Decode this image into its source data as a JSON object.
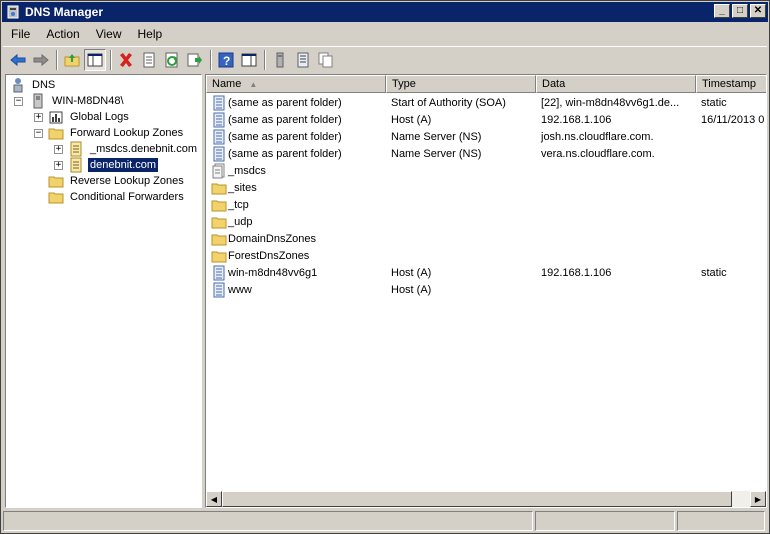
{
  "window": {
    "title": "DNS Manager",
    "controls": [
      "_",
      "□",
      "✕"
    ]
  },
  "menu": [
    "File",
    "Action",
    "View",
    "Help"
  ],
  "tree": {
    "root": "DNS",
    "server": "WIN-M8DN48\\",
    "global_logs": "Global Logs",
    "forward_zones": "Forward Lookup Zones",
    "msdcs_zone": "_msdcs.denebnit.com",
    "selected_zone": "denebnit.com",
    "reverse_zones": "Reverse Lookup Zones",
    "conditional_forwarders": "Conditional Forwarders"
  },
  "columns": {
    "name": "Name",
    "type": "Type",
    "data": "Data",
    "timestamp": "Timestamp"
  },
  "records": [
    {
      "icon": "record-icon",
      "name": "(same as parent folder)",
      "type": "Start of Authority (SOA)",
      "data": "[22], win-m8dn48vv6g1.de...",
      "timestamp": "static"
    },
    {
      "icon": "record-icon",
      "name": "(same as parent folder)",
      "type": "Host (A)",
      "data": "192.168.1.106",
      "timestamp": "16/11/2013 0"
    },
    {
      "icon": "record-icon",
      "name": "(same as parent folder)",
      "type": "Name Server (NS)",
      "data": "josh.ns.cloudflare.com.",
      "timestamp": ""
    },
    {
      "icon": "record-icon",
      "name": "(same as parent folder)",
      "type": "Name Server (NS)",
      "data": "vera.ns.cloudflare.com.",
      "timestamp": ""
    },
    {
      "icon": "delegation-icon",
      "name": "_msdcs",
      "type": "",
      "data": "",
      "timestamp": ""
    },
    {
      "icon": "folder-icon",
      "name": "_sites",
      "type": "",
      "data": "",
      "timestamp": ""
    },
    {
      "icon": "folder-icon",
      "name": "_tcp",
      "type": "",
      "data": "",
      "timestamp": ""
    },
    {
      "icon": "folder-icon",
      "name": "_udp",
      "type": "",
      "data": "",
      "timestamp": ""
    },
    {
      "icon": "folder-icon",
      "name": "DomainDnsZones",
      "type": "",
      "data": "",
      "timestamp": ""
    },
    {
      "icon": "folder-icon",
      "name": "ForestDnsZones",
      "type": "",
      "data": "",
      "timestamp": ""
    },
    {
      "icon": "record-icon",
      "name": "win-m8dn48vv6g1",
      "type": "Host (A)",
      "data": "192.168.1.106",
      "timestamp": "static"
    },
    {
      "icon": "record-icon",
      "name": "www",
      "type": "Host (A)",
      "data": "",
      "timestamp": ""
    }
  ],
  "colors": {
    "titlebar": "#0a246a",
    "selection": "#0a246a",
    "chrome": "#d4d0c8"
  }
}
